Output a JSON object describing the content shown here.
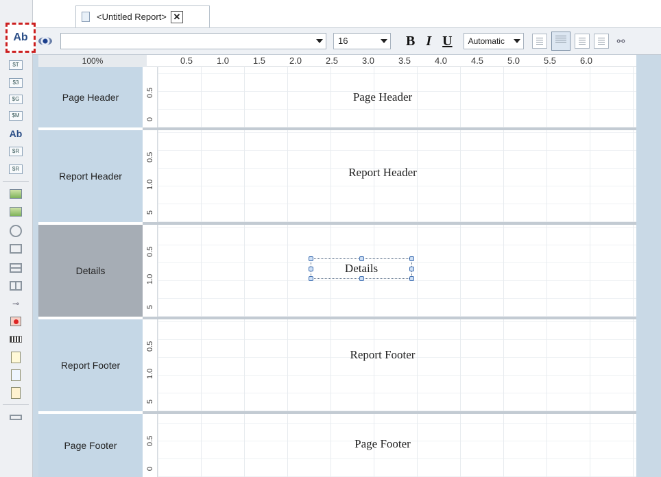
{
  "tab": {
    "title": "<Untitled Report>",
    "close_glyph": "✕"
  },
  "format_bar": {
    "font_name": "",
    "font_size": "16",
    "bold": "B",
    "italic": "I",
    "underline": "U",
    "color": "Automatic"
  },
  "zoom": "100%",
  "ruler": [
    "0.5",
    "1.0",
    "1.5",
    "2.0",
    "2.5",
    "3.0",
    "3.5",
    "4.0",
    "4.5",
    "5.0",
    "5.5",
    "6.0"
  ],
  "bands": [
    {
      "label": "Page Header",
      "text": "Page Header",
      "ticks": [
        "0.5",
        "0"
      ]
    },
    {
      "label": "Report Header",
      "text": "Report Header",
      "ticks": [
        "0.5",
        "1.0",
        "5"
      ]
    },
    {
      "label": "Details",
      "text": "Details",
      "ticks": [
        "0.5",
        "1.0",
        "5"
      ]
    },
    {
      "label": "Report Footer",
      "text": "Report Footer",
      "ticks": [
        "0.5",
        "1.0",
        "5"
      ]
    },
    {
      "label": "Page Footer",
      "text": "Page Footer",
      "ticks": [
        "0.5",
        "0"
      ]
    }
  ],
  "toolbox": {
    "selected_tool": "Ab",
    "tools": [
      "$T",
      "$3",
      "$G",
      "$M",
      "Ab",
      "$R",
      "$R"
    ]
  },
  "colors": {
    "band_label": "#c5d7e6",
    "band_selected": "#a6adb5",
    "highlight": "#cc1f1f"
  }
}
